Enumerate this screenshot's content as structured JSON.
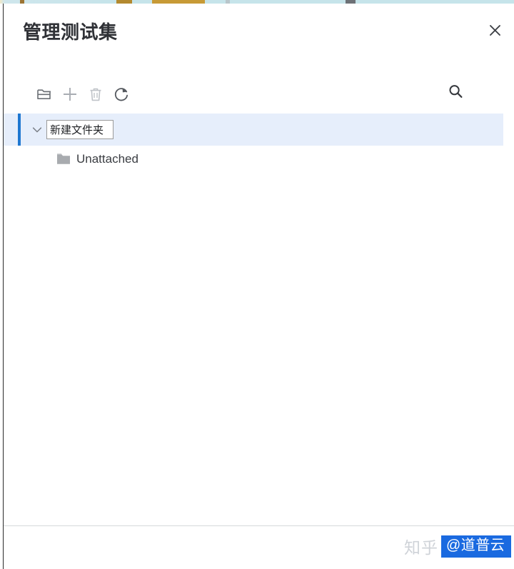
{
  "background_strip": {
    "name": "underlying-page-sliver",
    "base_color": "#c6e4ea",
    "accent_color": "#c79a36"
  },
  "dialog": {
    "title": "管理测试集",
    "close_label": "×",
    "close_icon": "close-icon",
    "border_color": "#2b2b2b",
    "background": "#ffffff"
  },
  "toolbar": {
    "items": [
      {
        "name": "new-folder",
        "icon": "new-folder-icon",
        "label": "新建文件夹",
        "enabled": true,
        "color": "#6b6f75"
      },
      {
        "name": "add",
        "icon": "plus-icon",
        "label": "新增",
        "enabled": true,
        "color": "#a9adb3"
      },
      {
        "name": "delete",
        "icon": "trash-icon",
        "label": "删除",
        "enabled": false,
        "color": "#bfc3c8"
      },
      {
        "name": "refresh",
        "icon": "refresh-icon",
        "label": "刷新",
        "enabled": true,
        "color": "#55595f"
      }
    ],
    "search": {
      "name": "search",
      "icon": "search-icon",
      "label": "搜索",
      "enabled": true
    }
  },
  "tree": {
    "selected_row": {
      "expanded": true,
      "chevron_icon": "chevron-down-icon",
      "editing": true,
      "input_value": "新建文件夹",
      "input_placeholder": "新建文件夹",
      "highlight_color": "#e6eefb",
      "accent_bar_color": "#1f78d1"
    },
    "children": [
      {
        "label": "Unattached",
        "icon": "folder-icon",
        "icon_color": "#a8abaf",
        "indent_level": 1
      }
    ]
  },
  "footer": {
    "divider_color": "#d6d8da"
  },
  "watermark": {
    "ghost_text": "知乎",
    "badge_text": "@道普云",
    "badge_color": "#1a6ae0"
  }
}
